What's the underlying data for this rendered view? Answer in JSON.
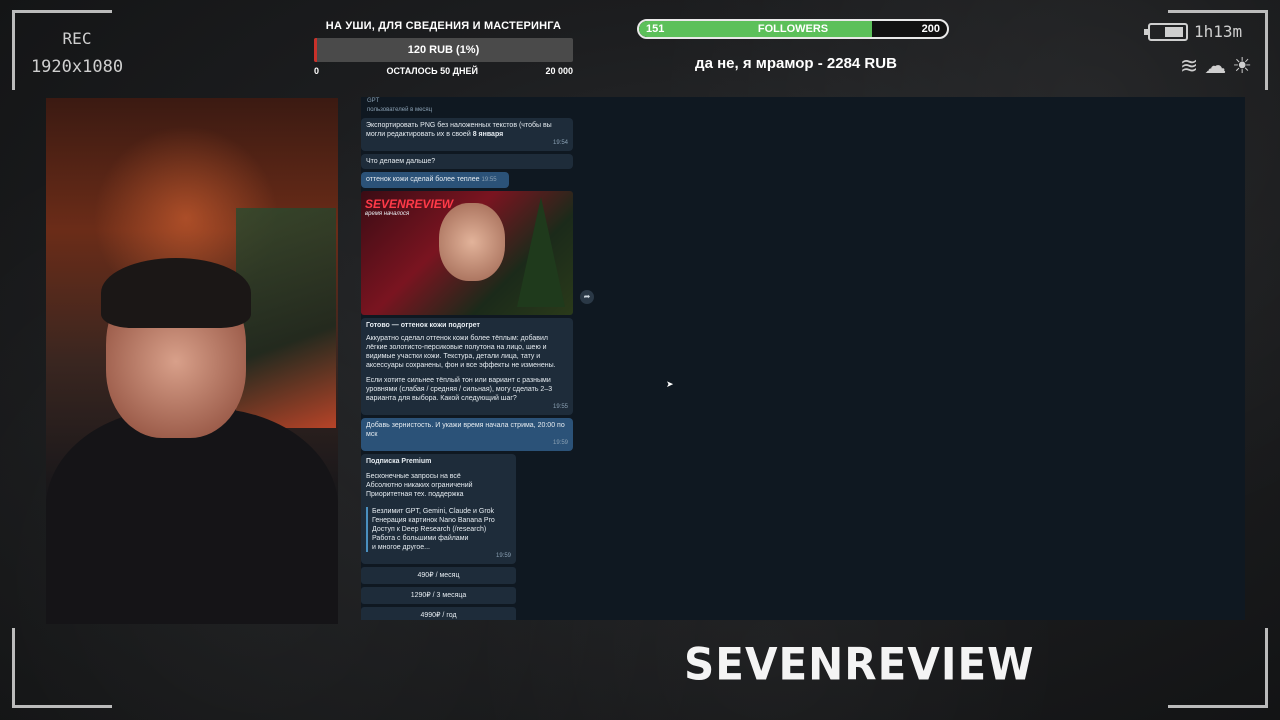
{
  "recording": {
    "label": "REC",
    "resolution": "1920x1080"
  },
  "donation_goal": {
    "title": "НА УШИ, ДЛЯ СВЕДЕНИЯ И МАСТЕРИНГА",
    "progress_label": "120 RUB (1%)",
    "progress_fraction": 0.01,
    "min": "0",
    "remaining": "ОСТАЛОСЬ 50 ДНЕЙ",
    "max": "20 000",
    "fill_color": "#c8312a"
  },
  "followers_goal": {
    "current": "151",
    "label": "FOLLOWERS",
    "target": "200",
    "progress_fraction": 0.755,
    "fill_color": "#5cc05a"
  },
  "last_donation": "да не, я мрамор - 2284 RUB",
  "status": {
    "battery_time": "1h13m",
    "weather_icons": "wind-cloud-sun-icons"
  },
  "chat": {
    "header_title": "GPT",
    "header_sub": "пользователей в месяц",
    "msg1": "Экспортировать PNG без наложенных текстов (чтобы вы могли редактировать их в своей",
    "date_badge": "8 января",
    "msg1_time": "19:54",
    "msg2": "Что делаем дальше?",
    "out1": "оттенок кожи сделай более теплее",
    "out1_time": "19:55",
    "preview_brand": "SEVENREVIEW",
    "preview_sub": "время началося",
    "result_title": "Готово — оттенок кожи подогрет",
    "result_body1": "Аккуратно сделал оттенок кожи более тёплым: добавил лёгкие золотисто-персиковые полутона на лицо, шею и видимые участки кожи. Текстура, детали лица, тату и аксессуары сохранены, фон и все эффекты не изменены.",
    "result_body2": "Если хотите сильнее тёплый тон или вариант с разными уровнями (слабая / средняя / сильная), могу сделать 2–3 варианта для выбора. Какой следующий шаг?",
    "result_time": "19:55",
    "out2": "Добавь зернистость. И укажи время начала стрима, 20:00 по мск",
    "out2_time": "19:59",
    "premium_title": "Подписка Premium",
    "premium_lines": "Бесконечные запросы на всё\nАбсолютно никаких ограничений\nПриоритетная тех. поддержка",
    "premium_quote": "Безлимит GPT, Gemini, Claude и Grok\nГенерация картинок Nano Banana Pro\nДоступ к Deep Research (/research)\nРабота с большими файлами\nи многое другое...",
    "premium_time": "19:59",
    "price1": "490₽ / месяц",
    "price2": "1290₽ / 3 месяца",
    "price3": "4990₽ / год"
  },
  "branding": {
    "logo_text": "SEVENREVIEW"
  }
}
